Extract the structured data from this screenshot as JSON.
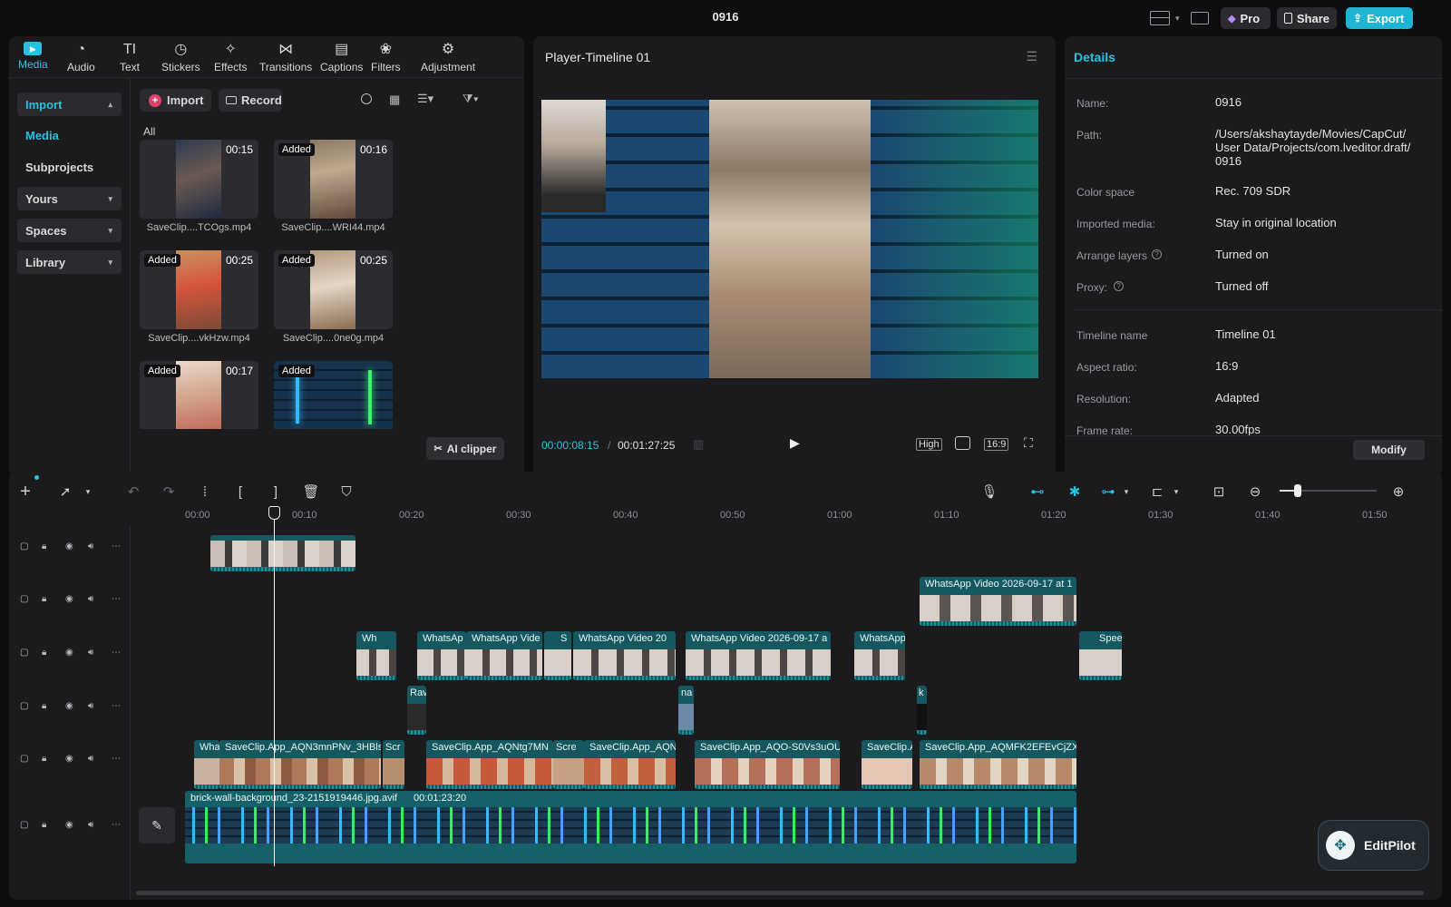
{
  "app": {
    "title": "0916"
  },
  "topbar": {
    "pro_label": "Pro",
    "share_label": "Share",
    "export_label": "Export"
  },
  "media_tabs": [
    {
      "label": "Media",
      "icon": "media-icon"
    },
    {
      "label": "Audio",
      "icon": "audio-icon"
    },
    {
      "label": "Text",
      "icon": "text-icon"
    },
    {
      "label": "Stickers",
      "icon": "stickers-icon"
    },
    {
      "label": "Effects",
      "icon": "effects-icon"
    },
    {
      "label": "Transitions",
      "icon": "transitions-icon"
    },
    {
      "label": "Captions",
      "icon": "captions-icon"
    },
    {
      "label": "Filters",
      "icon": "filters-icon"
    },
    {
      "label": "Adjustment",
      "icon": "adjustment-icon"
    }
  ],
  "left_nav": {
    "import": "Import",
    "media": "Media",
    "subprojects": "Subprojects",
    "yours": "Yours",
    "spaces": "Spaces",
    "library": "Library"
  },
  "media_toolbar": {
    "import": "Import",
    "record": "Record",
    "all": "All",
    "ai_clipper": "AI clipper"
  },
  "media_items": [
    {
      "name": "SaveClip....TCOgs.mp4",
      "duration": "00:15",
      "added": ""
    },
    {
      "name": "SaveClip....WRI44.mp4",
      "duration": "00:16",
      "added": "Added"
    },
    {
      "name": "SaveClip....vkHzw.mp4",
      "duration": "00:25",
      "added": "Added"
    },
    {
      "name": "SaveClip....0ne0g.mp4",
      "duration": "00:25",
      "added": "Added"
    },
    {
      "name": "",
      "duration": "00:17",
      "added": "Added"
    },
    {
      "name": "",
      "duration": "",
      "added": "Added"
    }
  ],
  "player": {
    "title": "Player-Timeline 01",
    "current_time": "00:00:08:15",
    "separator": "/",
    "total_time": "00:01:27:25",
    "quality": "High",
    "ratio": "16:9"
  },
  "details": {
    "title": "Details",
    "rows": [
      {
        "label": "Name:",
        "value": "0916"
      },
      {
        "label": "Path:",
        "value": "/Users/akshaytayde/Movies/CapCut/ User Data/Projects/com.lveditor.draft/ 0916"
      },
      {
        "label": "Color space",
        "value": "Rec. 709 SDR"
      },
      {
        "label": "Imported media:",
        "value": "Stay in original location"
      },
      {
        "label": "Arrange layers",
        "value": "Turned on"
      },
      {
        "label": "Proxy:",
        "value": "Turned off"
      },
      {
        "label": "Timeline name",
        "value": "Timeline 01"
      },
      {
        "label": "Aspect ratio:",
        "value": "16:9"
      },
      {
        "label": "Resolution:",
        "value": "Adapted"
      },
      {
        "label": "Frame rate:",
        "value": "30.00fps"
      }
    ],
    "modify_label": "Modify"
  },
  "ruler": [
    "00:00",
    "00:10",
    "00:20",
    "00:30",
    "00:40",
    "00:50",
    "01:00",
    "01:10",
    "01:20",
    "01:30",
    "01:40",
    "01:50"
  ],
  "clips": {
    "t2a": "WhatsApp Video 2026-09-17 at 1",
    "t3a": "Wh",
    "t3b": "WhatsAp",
    "t3c": "WhatsApp Vide",
    "t3d": "S",
    "t3e": "WhatsApp Video 20",
    "t3f": "WhatsApp Video 2026-09-17 a",
    "t3g": "WhatsApp",
    "t3h": "Spee",
    "t4a": "Rav",
    "t4b": "na",
    "t4c": "k",
    "t5a": "Wha",
    "t5b": "SaveClip.App_AQN3mnPNv_3HBls_",
    "t5c": "Scr",
    "t5d": "SaveClip.App_AQNtg7MN",
    "t5e": "Scre",
    "t5f": "SaveClip.App_AQN",
    "t5g": "SaveClip.App_AQO-S0Vs3uOU",
    "t5h": "SaveClip.A",
    "t5i": "SaveClip.App_AQMFK2EFEvCjZXv",
    "bg_name": "brick-wall-background_23-2151919446.jpg.avif",
    "bg_dur": "00:01:23:20"
  },
  "editpilot": "EditPilot",
  "colors": {
    "accent": "#27c1e0",
    "clip": "#16585f",
    "panel": "#1b1b1e"
  }
}
